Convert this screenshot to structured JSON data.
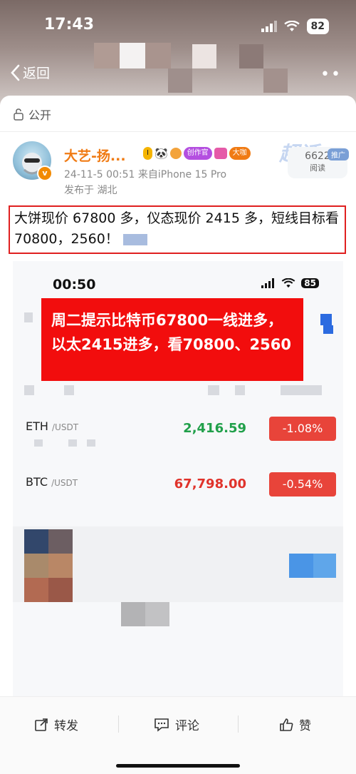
{
  "status_bar": {
    "time": "17:43",
    "battery": "82"
  },
  "nav": {
    "back_label": "返回"
  },
  "post": {
    "visibility": "公开",
    "author": {
      "name": "大艺-扬...",
      "level": "I",
      "badge_creator": "创作官",
      "badge_fans": "大咖"
    },
    "read_count": "6622",
    "read_label": "阅读",
    "promo_tag": "推广",
    "watermark": "超话",
    "time_device": "24-11-5 00:51  来自iPhone 15 Pro",
    "location": "发布于 湖北",
    "text": "大饼现价 67800 多，仪态现价 2415 多，短线目标看 70800，2560！"
  },
  "embed": {
    "status_time": "00:50",
    "battery": "85",
    "banner_line1": "周二提示比特币67800一线进多，",
    "banner_line2": "以太2415进多，看70800、2560",
    "tickers": [
      {
        "symbol": "ETH",
        "quote": "/USDT",
        "price": "2,416.59",
        "change": "-1.08%",
        "price_color": "#21a04a"
      },
      {
        "symbol": "BTC",
        "quote": "/USDT",
        "price": "67,798.00",
        "change": "-0.54%",
        "price_color": "#e0332b"
      }
    ]
  },
  "footer": {
    "repost": "转发",
    "comment": "评论",
    "like": "赞"
  },
  "colors": {
    "accent_orange": "#f07b14",
    "highlight_red": "#e02020",
    "negative_red": "#e8443a"
  }
}
